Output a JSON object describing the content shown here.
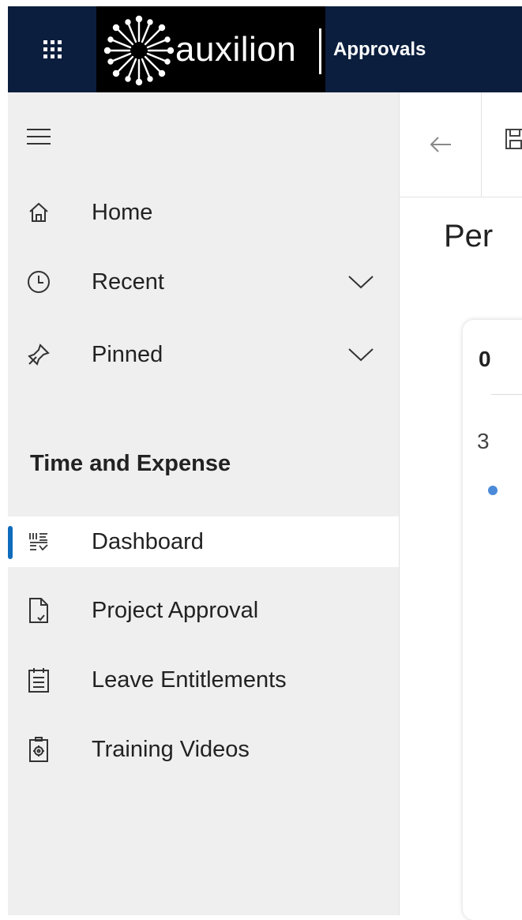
{
  "header": {
    "logo_text": "auxilion",
    "app_title": "Approvals",
    "colors": {
      "bar": "#0b1e3d",
      "logo_bg": "#000000"
    }
  },
  "nav": {
    "items": [
      {
        "label": "Home",
        "icon": "home-icon"
      },
      {
        "label": "Recent",
        "icon": "clock-icon",
        "expandable": true
      },
      {
        "label": "Pinned",
        "icon": "pin-icon",
        "expandable": true
      }
    ],
    "section_title": "Time and Expense",
    "section_items": [
      {
        "label": "Dashboard",
        "icon": "dashboard-icon",
        "active": true
      },
      {
        "label": "Project Approval",
        "icon": "document-icon"
      },
      {
        "label": "Leave Entitlements",
        "icon": "calendar-icon"
      },
      {
        "label": "Training Videos",
        "icon": "badge-icon"
      }
    ],
    "active_color": "#0f6cbd"
  },
  "main": {
    "page_title": "Per",
    "card": {
      "value1": "0",
      "value2": "3"
    }
  }
}
